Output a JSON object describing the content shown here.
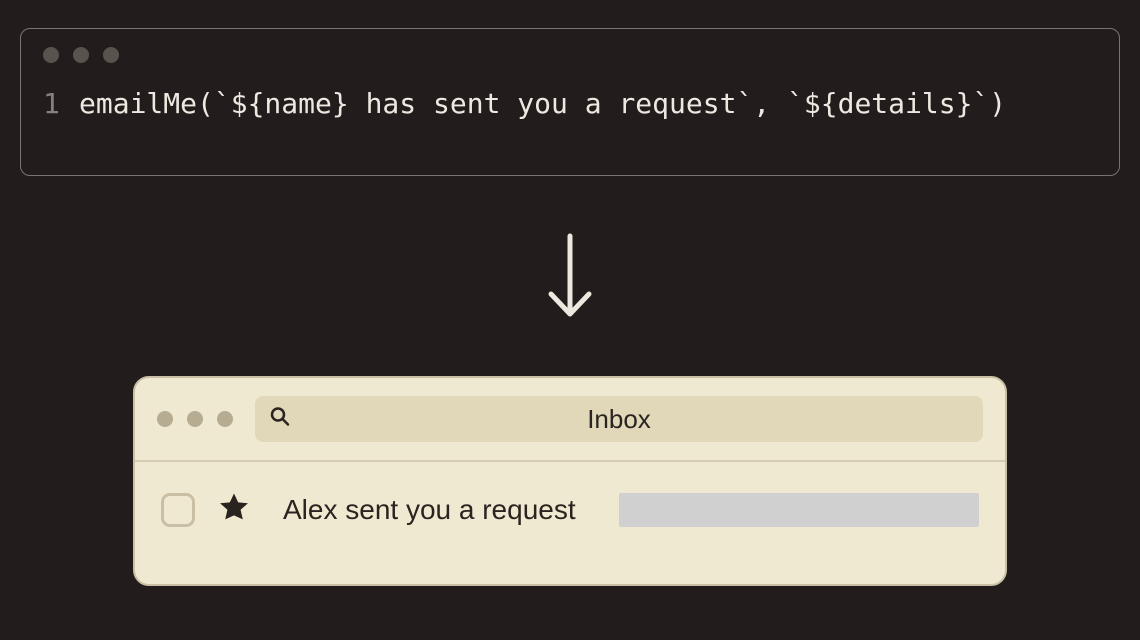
{
  "code": {
    "line_number": "1",
    "content": "emailMe(`${name} has sent you a request`, `${details}`)"
  },
  "email": {
    "search_title": "Inbox",
    "subject": "Alex sent you a request"
  }
}
